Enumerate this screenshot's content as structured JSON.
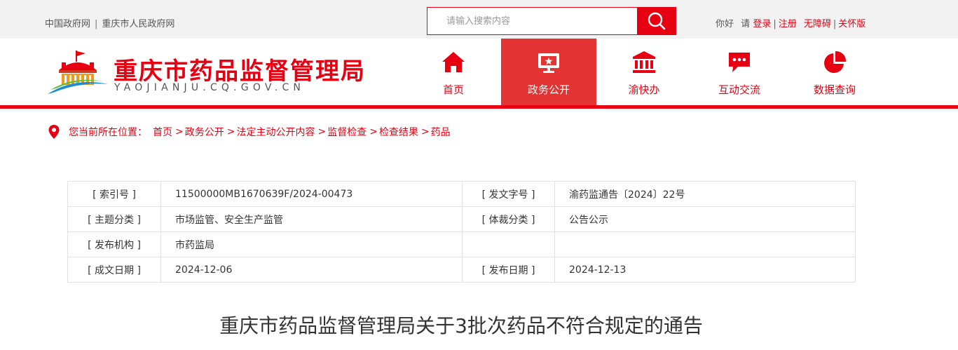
{
  "topbar": {
    "links": [
      "中国政府网",
      "重庆市人民政府网"
    ],
    "search_placeholder": "请输入搜索内容",
    "greeting": "你好",
    "please": "请",
    "login": "登录",
    "register": "注册",
    "accessibility": "无障碍",
    "care_mode": "关怀版"
  },
  "header": {
    "title": "重庆市药品监督管理局",
    "subtitle": "YAOJIANJU.CQ.GOV.CN"
  },
  "nav": {
    "items": [
      {
        "label": "首页",
        "icon": "home-icon"
      },
      {
        "label": "政务公开",
        "icon": "monitor-icon",
        "active": true
      },
      {
        "label": "渝快办",
        "icon": "bank-icon"
      },
      {
        "label": "互动交流",
        "icon": "chat-icon"
      },
      {
        "label": "数据查询",
        "icon": "pie-chart-icon"
      }
    ]
  },
  "breadcrumb": {
    "lead": "您当前所在位置：",
    "items": [
      "首页",
      "政务公开",
      "法定主动公开内容",
      "监督检查",
      "检查结果",
      "药品"
    ]
  },
  "meta": {
    "index_label": "[ 索引号 ]",
    "index_value": "11500000MB1670639F/2024-00473",
    "docno_label": "[ 发文字号 ]",
    "docno_value": "渝药监通告〔2024〕22号",
    "topic_label": "[ 主题分类 ]",
    "topic_value": "市场监管、安全生产监管",
    "genre_label": "[ 体裁分类 ]",
    "genre_value": "公告公示",
    "org_label": "[ 发布机构 ]",
    "org_value": "市药监局",
    "written_label": "[ 成文日期 ]",
    "written_value": "2024-12-06",
    "pub_label": "[ 发布日期 ]",
    "pub_value": "2024-12-13"
  },
  "document": {
    "title": "重庆市药品监督管理局关于3批次药品不符合规定的通告"
  },
  "colors": {
    "brand_red": "#e60012",
    "nav_active": "#e33333",
    "topbar_bg": "#f2f2f2"
  }
}
